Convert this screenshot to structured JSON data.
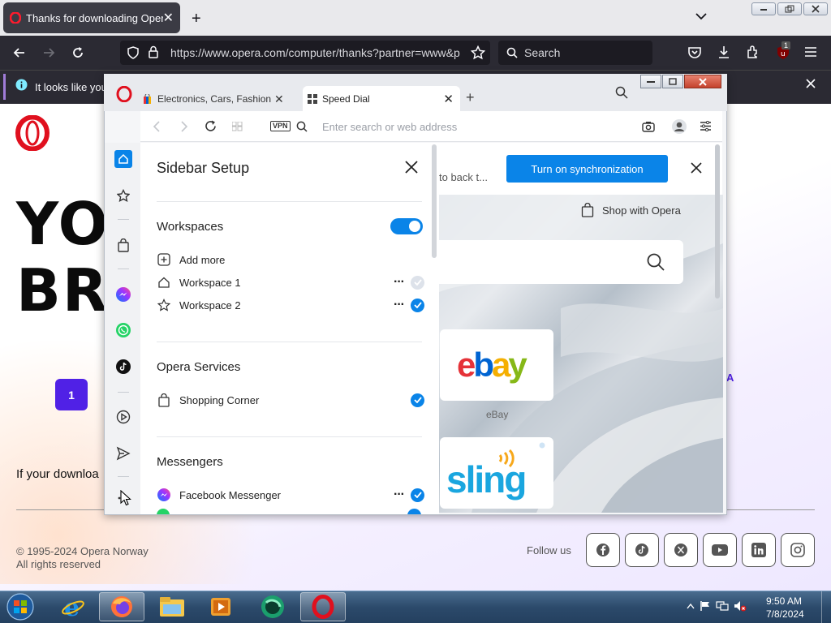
{
  "firefox": {
    "tab_title": "Thanks for downloading Opera",
    "url": "https://www.opera.com/computer/thanks?partner=www&p",
    "search_placeholder": "Search",
    "notification_text": "It looks like you",
    "extension_badge": "1"
  },
  "page": {
    "hero_line1": "YOU",
    "hero_line2": "BRO",
    "step_number": "1",
    "step_letter": "A",
    "download_text": "If your downloa",
    "copyright": "© 1995-2024 Opera Norway",
    "rights": "All rights reserved",
    "follow_us": "Follow us",
    "social_icons": [
      "facebook-icon",
      "tiktok-icon",
      "x-icon",
      "youtube-icon",
      "linkedin-icon",
      "instagram-icon"
    ]
  },
  "opera": {
    "tabs": [
      {
        "label": "Electronics, Cars, Fashion, C"
      },
      {
        "label": "Speed Dial"
      }
    ],
    "address_placeholder": "Enter search or web address",
    "vpn_label": "VPN",
    "sidebar_setup": {
      "title": "Sidebar Setup",
      "sections": {
        "workspaces": {
          "title": "Workspaces",
          "enabled": true,
          "add_more": "Add more",
          "items": [
            {
              "label": "Workspace 1",
              "checked": false
            },
            {
              "label": "Workspace 2",
              "checked": true
            }
          ]
        },
        "services": {
          "title": "Opera Services",
          "items": [
            {
              "label": "Shopping Corner",
              "checked": true
            }
          ]
        },
        "messengers": {
          "title": "Messengers",
          "items": [
            {
              "label": "Facebook Messenger",
              "checked": true
            }
          ]
        }
      }
    },
    "speed_dial": {
      "sync_text": "to back t...",
      "sync_button": "Turn on synchronization",
      "shop_button": "Shop with Opera",
      "tiles": [
        {
          "name": "eBay",
          "logo": "ebay"
        },
        {
          "name": "",
          "logo": "sling"
        }
      ]
    }
  },
  "taskbar": {
    "time": "9:50 AM",
    "date": "7/8/2024"
  },
  "colors": {
    "opera_red": "#e0101e",
    "accent_blue": "#0a84e8",
    "purple": "#5021e6"
  }
}
